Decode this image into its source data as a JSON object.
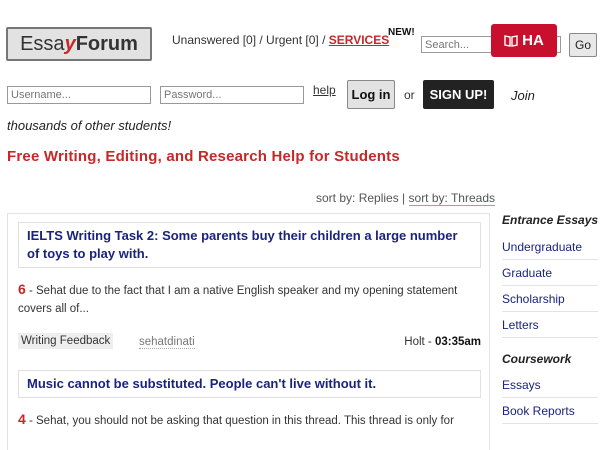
{
  "header": {
    "logo_essay": "Essa",
    "logo_y": "y",
    "logo_forum": "Forum",
    "nav_text": "Unanswered [0] / Urgent [0] / ",
    "services": "SERVICES",
    "new_badge": "NEW!",
    "search_placeholder": "Search...",
    "ha_badge": "HA",
    "go_label": "Go"
  },
  "login": {
    "username_placeholder": "Username...",
    "password_placeholder": "Password...",
    "help_label": "help",
    "login_label": "Log in",
    "or_text": "or",
    "signup_label": "SIGN UP!",
    "join_text": "Join",
    "join_text_2": "thousands of other students!"
  },
  "headline": "Free Writing, Editing, and Research Help for Students",
  "sort": {
    "prefix": "sort by: ",
    "replies": "Replies",
    "separator": " | ",
    "threads": "sort by: Threads"
  },
  "threads": [
    {
      "title": "IELTS Writing Task 2: Some parents buy their children a large number of toys to play with.",
      "reply_count": "6",
      "preview": " - Sehat due to the fact that I am a native English speaker and my opening statement covers all of...",
      "tag": "Writing Feedback",
      "author": "sehatdinati",
      "last_user": "Holt - ",
      "last_time": "03:35am"
    },
    {
      "title": "Music cannot be substituted. People can't live without it.",
      "reply_count": "4",
      "preview": " - Sehat, you should not be asking that question in this thread. This thread is only for"
    }
  ],
  "sidebar": {
    "sections": [
      {
        "heading": "Entrance Essays",
        "items": [
          "Undergraduate",
          "Graduate",
          "Scholarship",
          "Letters"
        ]
      },
      {
        "heading": "Coursework",
        "items": [
          "Essays",
          "Book Reports"
        ]
      }
    ]
  }
}
